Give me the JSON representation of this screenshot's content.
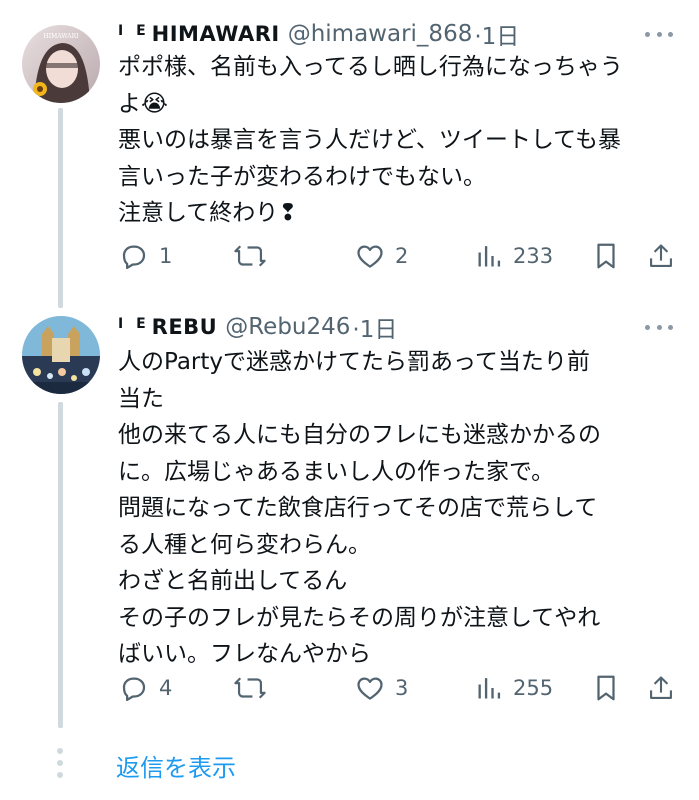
{
  "tweets": [
    {
      "display_name_prefix": "I E",
      "display_name": "HIMAWARI",
      "avatar_text": "HIMAWARI",
      "handle": "@himawari_868",
      "time": "·1日",
      "lines": [
        "ポポ様、名前も入ってるし晒し行為になっちゃう",
        "よ😭",
        "悪いのは暴言を言う人だけど、ツイートしても暴",
        "言いった子が変わるわけでもない。",
        "注意して終わり❢"
      ],
      "replies": "1",
      "retweets": "",
      "likes": "2",
      "views": "233"
    },
    {
      "display_name_prefix": "I E",
      "display_name": "REBU",
      "handle": "@Rebu246",
      "time": "·1日",
      "lines": [
        "人のPartyで迷惑かけてたら罰あって当たり前",
        "当た",
        "他の来てる人にも自分のフレにも迷惑かかるの",
        "に。広場じゃあるまいし人の作った家で。",
        "問題になってた飲食店行ってその店で荒らして",
        "る人種と何ら変わらん。",
        "わざと名前出してるん",
        "その子のフレが見たらその周りが注意してやれ",
        "ばいい。フレなんやから"
      ],
      "replies": "4",
      "retweets": "",
      "likes": "3",
      "views": "255"
    }
  ],
  "show_replies_label": "返信を表示",
  "colors": {
    "accent": "#1d9bf0",
    "muted": "#536471",
    "line": "#cfd9de"
  },
  "icons": [
    "reply-icon",
    "retweet-icon",
    "like-icon",
    "views-icon",
    "bookmark-icon",
    "share-icon",
    "more-icon"
  ]
}
